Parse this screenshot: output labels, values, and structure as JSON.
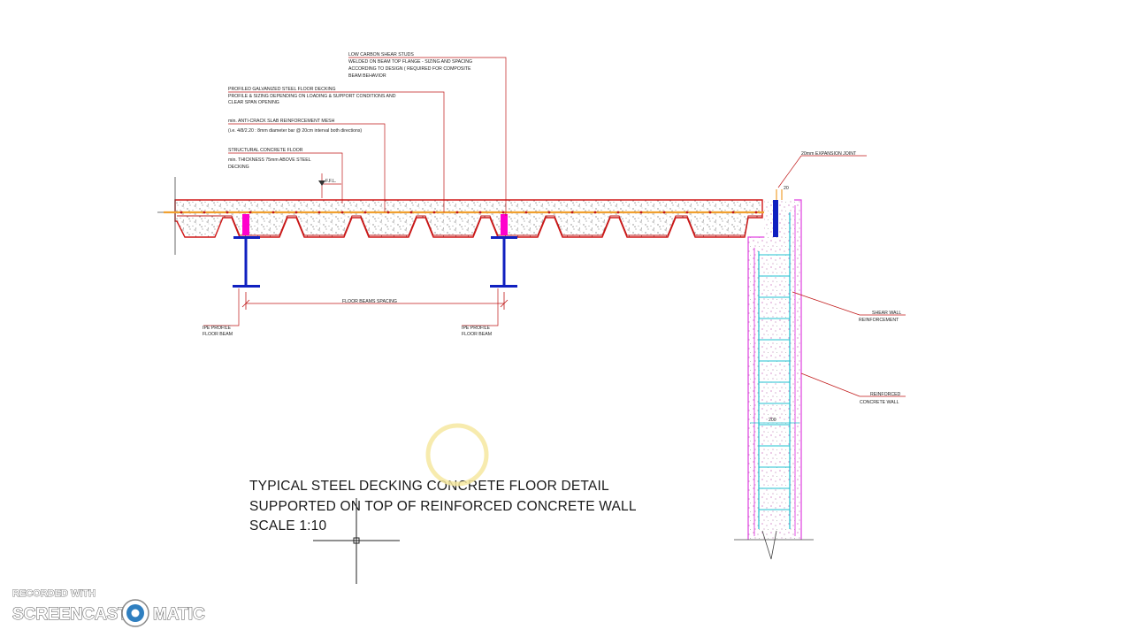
{
  "colors": {
    "slab_outline": "#d01818",
    "leader": "#c01818",
    "beam": "#1020c0",
    "stud": "#ff00cc",
    "rebar": "#f0a030",
    "wall_outline": "#e040e0",
    "wall_rebar": "#20c0d0",
    "cursor_ring": "#f6e8a0"
  },
  "annotations": {
    "shear_studs": {
      "lines": [
        "LOW CARBON SHEAR STUDS",
        "WELDED ON BEAM TOP FLANGE - SIZING AND SPACING",
        "ACCORDING TO DESIGN ( REQUIRED FOR COMPOSITE",
        "BEAM BEHAVIOR"
      ]
    },
    "decking": {
      "lines": [
        "PROFILED GALVANIZED STEEL FLOOR DECKING",
        "PROFILE & SIZING DEPENDING ON LOADING & SUPPORT CONDITIONS AND",
        "CLEAR SPAN OPENING"
      ]
    },
    "mesh": {
      "lines": [
        "min. ANTI-CRACK SLAB REINFORCEMENT MESH",
        "(i.e. 4/8/2.20 : 8mm diameter bar @ 20cm interval both directions)"
      ]
    },
    "concrete_floor": {
      "lines": [
        "STRUCTURAL CONCRETE FLOOR",
        "min. THICKNESS 75mm ABOVE STEEL",
        "DECKING"
      ]
    },
    "ffl": "F.F.L.",
    "expansion_joint": "20mm EXPANSION JOINT",
    "shear_wall": {
      "lines": [
        "SHEAR WALL",
        "REINFORCEMENT"
      ]
    },
    "rc_wall": {
      "lines": [
        "REINFORCED",
        "CONCRETE WALL"
      ]
    },
    "beam_spacing": "FLOOR BEAMS SPACING",
    "beam_left": {
      "lines": [
        "IPE PROFILE",
        "FLOOR BEAM"
      ]
    },
    "beam_right": {
      "lines": [
        "IPE PROFILE",
        "FLOOR BEAM"
      ]
    },
    "joint_dim": "20",
    "wall_dim": "200"
  },
  "title": {
    "line1": "TYPICAL STEEL DECKING CONCRETE FLOOR DETAIL",
    "line2": "SUPPORTED ON TOP OF REINFORCED CONCRETE WALL",
    "line3": "SCALE 1:10"
  },
  "watermark": {
    "small": "RECORDED WITH",
    "left": "SCREENCAST",
    "right": "MATIC"
  }
}
